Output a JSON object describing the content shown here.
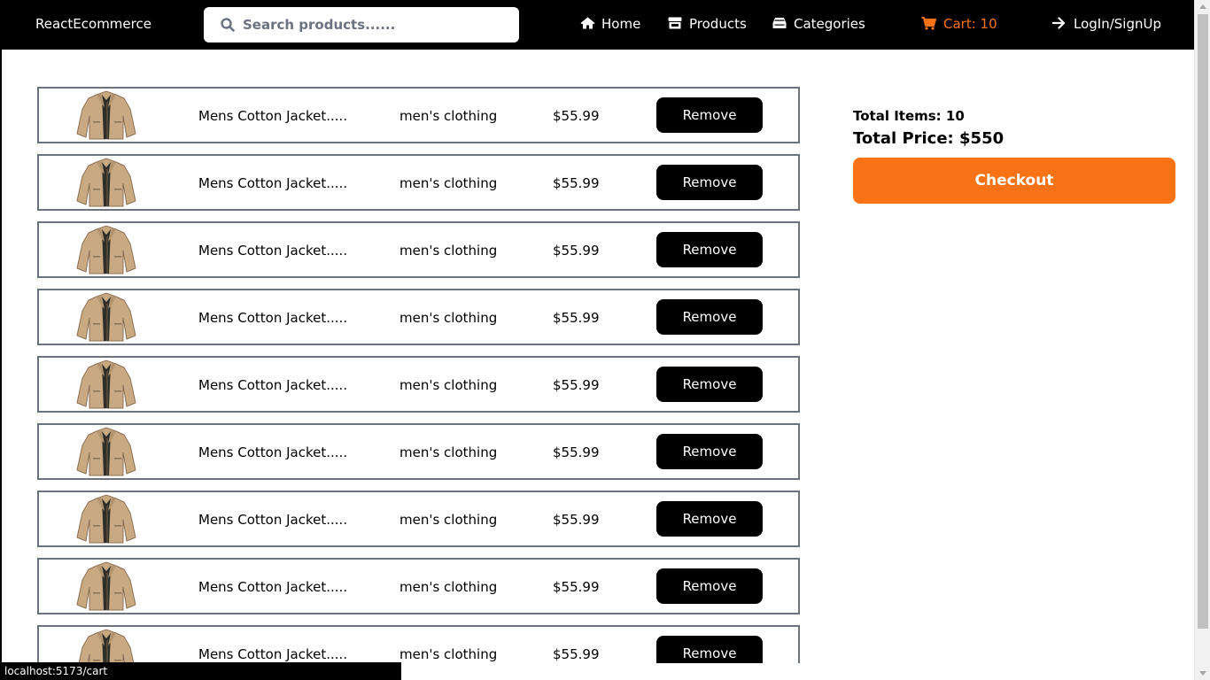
{
  "nav": {
    "brand": "ReactEcommerce",
    "search_placeholder": "Search products......",
    "home": "Home",
    "products": "Products",
    "categories": "Categories",
    "cart": "Cart: 10",
    "login": "LogIn/SignUp",
    "icons": {
      "search": "search-icon",
      "home": "home-icon",
      "products": "store-icon",
      "categories": "inbox-icon",
      "cart": "shopping-cart-icon",
      "login": "arrow-right-icon"
    }
  },
  "cart_items": [
    {
      "title": "Mens Cotton Jacket.....",
      "category": "men's clothing",
      "price": "$55.99",
      "remove": "Remove"
    },
    {
      "title": "Mens Cotton Jacket.....",
      "category": "men's clothing",
      "price": "$55.99",
      "remove": "Remove"
    },
    {
      "title": "Mens Cotton Jacket.....",
      "category": "men's clothing",
      "price": "$55.99",
      "remove": "Remove"
    },
    {
      "title": "Mens Cotton Jacket.....",
      "category": "men's clothing",
      "price": "$55.99",
      "remove": "Remove"
    },
    {
      "title": "Mens Cotton Jacket.....",
      "category": "men's clothing",
      "price": "$55.99",
      "remove": "Remove"
    },
    {
      "title": "Mens Cotton Jacket.....",
      "category": "men's clothing",
      "price": "$55.99",
      "remove": "Remove"
    },
    {
      "title": "Mens Cotton Jacket.....",
      "category": "men's clothing",
      "price": "$55.99",
      "remove": "Remove"
    },
    {
      "title": "Mens Cotton Jacket.....",
      "category": "men's clothing",
      "price": "$55.99",
      "remove": "Remove"
    },
    {
      "title": "Mens Cotton Jacket.....",
      "category": "men's clothing",
      "price": "$55.99",
      "remove": "Remove"
    }
  ],
  "summary": {
    "total_items": "Total Items: 10",
    "total_price": "Total Price: $550",
    "checkout": "Checkout"
  },
  "status_url": "localhost:5173/cart",
  "colors": {
    "accent": "#f97316",
    "nav_bg": "#000000",
    "border": "#6b7280",
    "jacket": "#c8a982"
  }
}
